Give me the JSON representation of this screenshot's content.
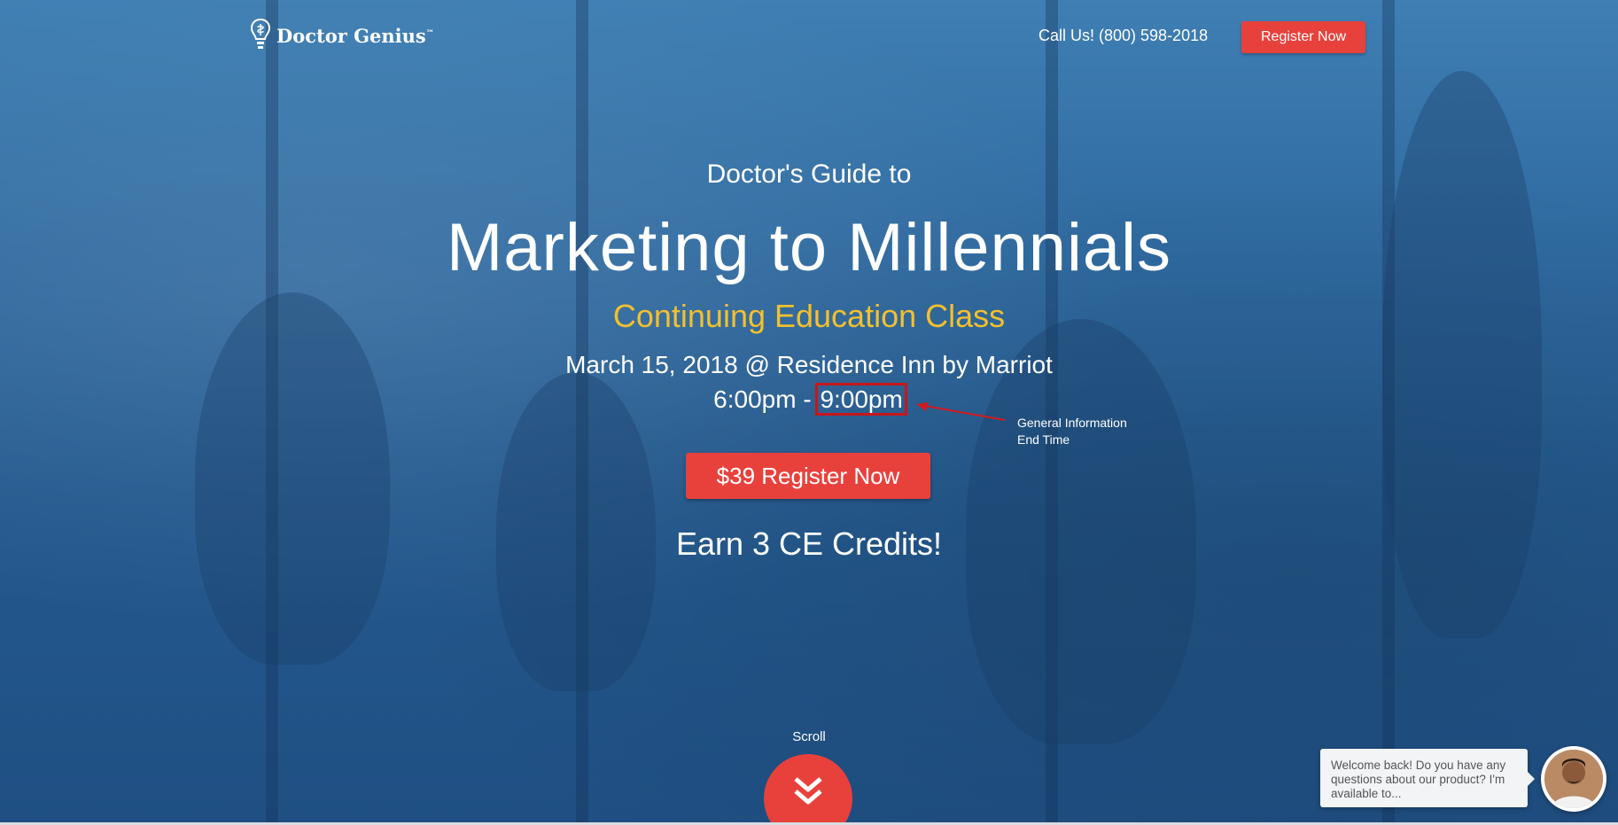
{
  "brand": {
    "name": "Doctor Genius",
    "tm": "™"
  },
  "header": {
    "call": "Call Us! (800) 598-2018",
    "register_label": "Register Now"
  },
  "hero": {
    "pretitle": "Doctor's Guide to",
    "title": "Marketing to Millennials",
    "subtitle": "Continuing Education Class",
    "date_line": "March 15, 2018 @ Residence Inn by Marriot",
    "time_start": "6:00pm -",
    "time_end": "9:00pm",
    "register_label": "$39 Register Now",
    "credits": "Earn 3 CE Credits!"
  },
  "annotation": {
    "line1": "General Information",
    "line2": "End Time"
  },
  "scroll": {
    "label": "Scroll"
  },
  "chat": {
    "message": "Welcome back! Do you have any questions about our product? I'm available to..."
  },
  "colors": {
    "accent": "#e8413c",
    "subtitle": "#f2c02e",
    "overlay": "#2f6aa0",
    "highlight_box": "#c8161b"
  },
  "icons": [
    "lightbulb-logo-icon",
    "chevron-double-down-icon"
  ]
}
